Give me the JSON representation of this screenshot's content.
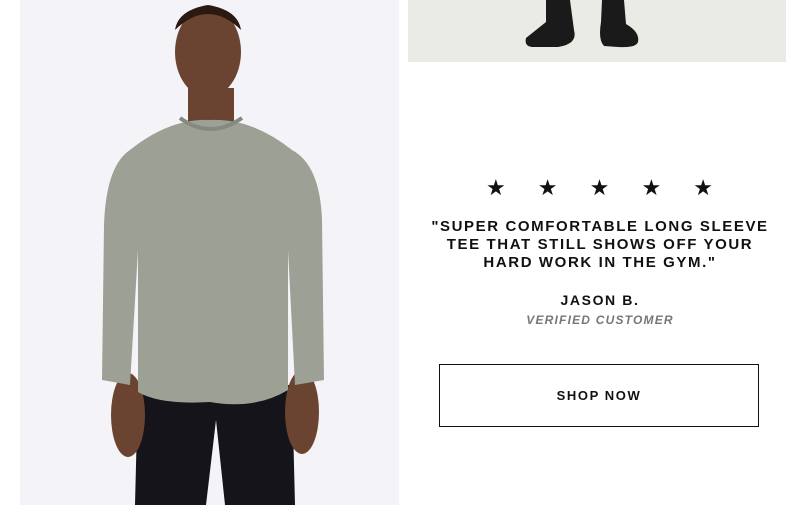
{
  "review": {
    "stars": "★ ★ ★ ★ ★",
    "quote": "\"SUPER COMFORTABLE LONG SLEEVE TEE THAT STILL SHOWS OFF YOUR HARD WORK IN THE GYM.\"",
    "author": "JASON B.",
    "status": "VERIFIED CUSTOMER"
  },
  "cta": {
    "label": "SHOP NOW"
  },
  "colors": {
    "shirt": "#9da095",
    "pants": "#15141a",
    "skin": "#6b4431",
    "backdrop": "#f4f4f8"
  }
}
